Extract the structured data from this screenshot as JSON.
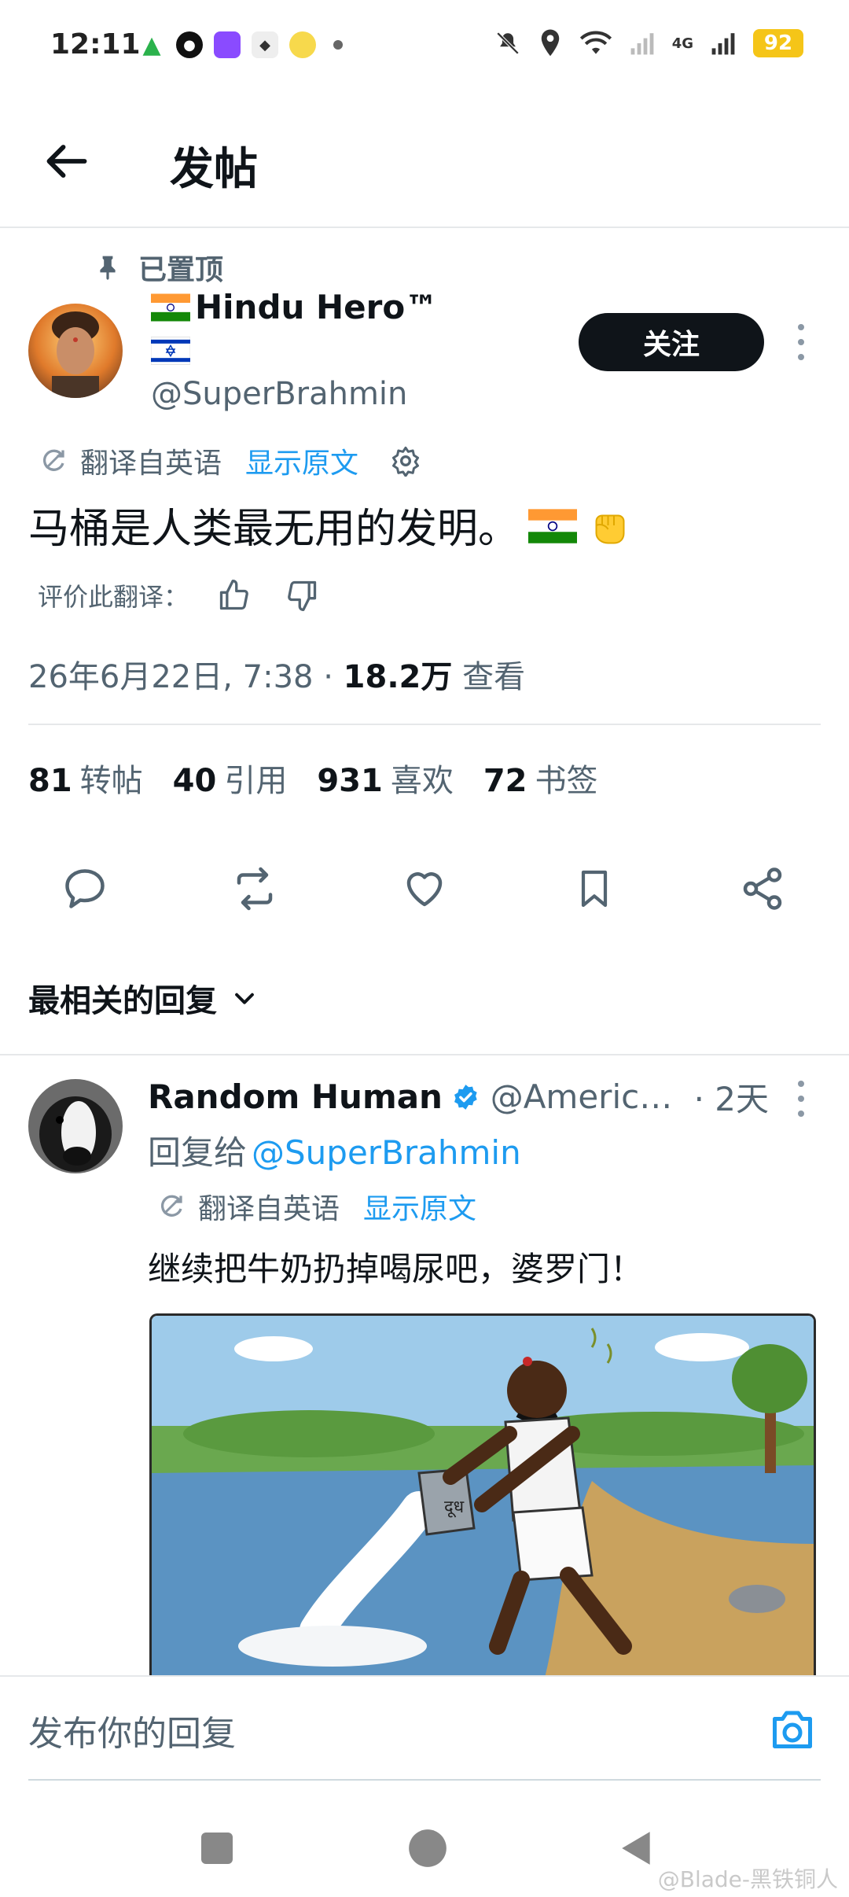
{
  "status_bar": {
    "time": "12:11",
    "network": "4G",
    "battery": "92"
  },
  "header": {
    "title": "发帖"
  },
  "post": {
    "pinned_label": "已置顶",
    "author_name": "Hindu Hero™",
    "author_handle": "@SuperBrahmin",
    "follow_label": "关注",
    "translated_from": "翻译自英语",
    "show_original": "显示原文",
    "text": "马桶是人类最无用的发明。",
    "rate_label": "评价此翻译：",
    "timestamp": "26年6月22日, 7:38 · ",
    "views_count": "18.2万",
    "views_label": " 查看",
    "stats": [
      {
        "count": "81",
        "label": "转帖"
      },
      {
        "count": "40",
        "label": "引用"
      },
      {
        "count": "931",
        "label": "喜欢"
      },
      {
        "count": "72",
        "label": "书签"
      }
    ]
  },
  "replies": {
    "sort_label": "最相关的回复",
    "items": [
      {
        "name": "Random Human",
        "handle": "@America1...",
        "time": "· 2天",
        "reply_to_label": "回复给",
        "reply_to_handle": "@SuperBrahmin",
        "translated_from": "翻译自英语",
        "show_original": "显示原文",
        "text": "继续把牛奶扔掉喝尿吧，婆罗门！",
        "image_text": "दूध"
      }
    ]
  },
  "compose": {
    "placeholder": "发布你的回复"
  },
  "watermark": "@Blade-黑铁铜人",
  "colors": {
    "link": "#1d9bf0",
    "secondary": "#536471",
    "primary_text": "#0f1419",
    "follow_bg": "#0f1419",
    "verified": "#1d9bf0"
  }
}
